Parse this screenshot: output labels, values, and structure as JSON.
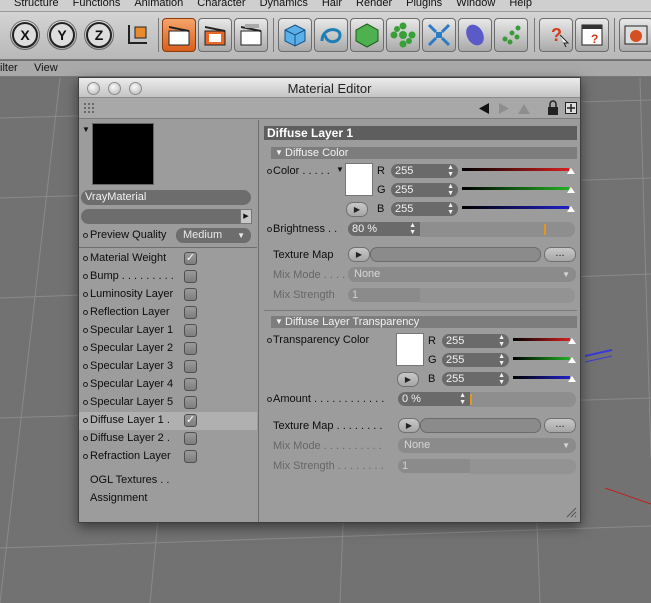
{
  "menubar": [
    "Structure",
    "Functions",
    "Animation",
    "Character",
    "Dynamics",
    "Hair",
    "Render",
    "Plugins",
    "Window",
    "Help"
  ],
  "submenu": {
    "items": [
      "ilter",
      "View"
    ]
  },
  "window": {
    "title": "Material Editor"
  },
  "left": {
    "material_name": "VrayMaterial",
    "preview_quality_label": "Preview Quality",
    "preview_quality_value": "Medium",
    "channels": [
      {
        "label": "Material Weight",
        "checked": true
      },
      {
        "label": "Bump . . . . . . . . .",
        "checked": false
      },
      {
        "label": "Luminosity Layer",
        "checked": false
      },
      {
        "label": "Reflection Layer",
        "checked": false
      },
      {
        "label": "Specular Layer 1",
        "checked": false
      },
      {
        "label": "Specular Layer 2",
        "checked": false
      },
      {
        "label": "Specular Layer 3",
        "checked": false
      },
      {
        "label": "Specular Layer 4",
        "checked": false
      },
      {
        "label": "Specular Layer 5",
        "checked": false
      },
      {
        "label": "Diffuse Layer 1 .",
        "checked": true
      },
      {
        "label": "Diffuse Layer 2 .",
        "checked": false
      },
      {
        "label": "Refraction Layer",
        "checked": false
      }
    ],
    "ogl_textures": "OGL Textures . .",
    "assignment": "Assignment"
  },
  "right": {
    "section_title": "Diffuse Layer 1",
    "diffuse_color_title": "Diffuse Color",
    "color_label": "Color . . . . .",
    "color_r": "255",
    "color_g": "255",
    "color_b": "255",
    "brightness_label": "Brightness . .",
    "brightness_value": "80 %",
    "brightness": 0.8,
    "texture_map_label": "Texture Map",
    "mix_mode_label": "Mix Mode . . . .",
    "mix_mode_value": "None",
    "mix_strength_label": "Mix Strength",
    "mix_strength_value": "1",
    "transparency_title": "Diffuse Layer Transparency",
    "transparency_color_label": "Transparency Color",
    "trans_r": "255",
    "trans_g": "255",
    "trans_b": "255",
    "amount_label": "Amount . . . . . . . . . . . .",
    "amount_value": "0 %",
    "amount": 0,
    "texture_map2_label": "Texture Map . . . . . . . .",
    "mix_mode2_label": "Mix Mode . . . . . . . . . .",
    "mix_mode2_value": "None",
    "mix_strength2_label": "Mix Strength . . . . . . . .",
    "mix_strength2_value": "1",
    "rgb_labels": [
      "R",
      "G",
      "B"
    ],
    "dots": "..."
  },
  "colors": {
    "accent_orange": "#e69520",
    "red": "#d62020",
    "green": "#22b022",
    "blue": "#2020c8"
  }
}
